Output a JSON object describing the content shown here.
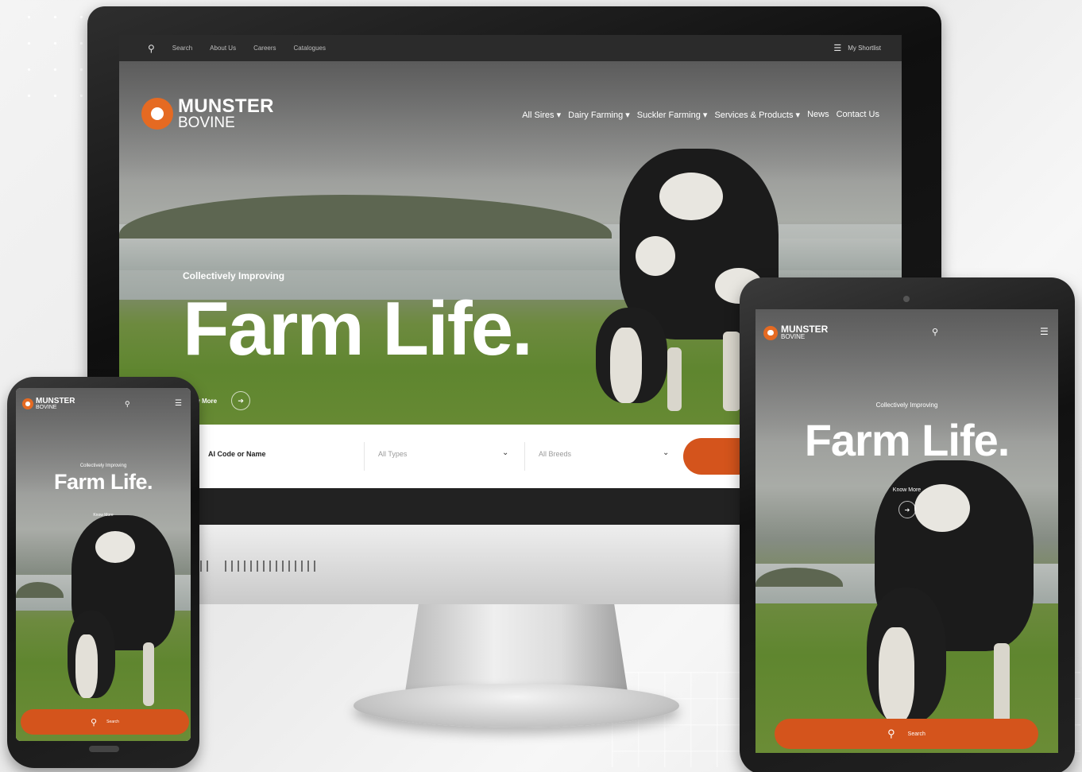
{
  "brand": {
    "name_line1": "MUNSTER",
    "name_line2": "BOVINE",
    "accent_color": "#d4541c"
  },
  "desktop": {
    "topbar": {
      "search_icon": "search-icon",
      "search_label": "Search",
      "links": [
        "About Us",
        "Careers",
        "Catalogues"
      ],
      "shortlist_icon": "list-icon",
      "shortlist_label": "My Shortlist"
    },
    "nav": [
      "All Sires ▾",
      "Dairy Farming ▾",
      "Suckler Farming ▾",
      "Services & Products ▾",
      "News",
      "Contact Us"
    ],
    "hero": {
      "kicker": "Collectively Improving",
      "title": "Farm Life.",
      "cta_label": "Know More",
      "cta_icon": "arrow-right-icon"
    },
    "search_bar": {
      "code_placeholder": "AI Code or Name",
      "types_select": "All Types",
      "breeds_select": "All Breeds",
      "dropdown_icon": "chevron-down-icon"
    }
  },
  "phone": {
    "hero": {
      "kicker": "Collectively Improving",
      "title": "Farm Life.",
      "cta_label": "Know More"
    },
    "search_button_label": "Search",
    "search_icon": "search-icon",
    "menu_icon": "menu-icon"
  },
  "tablet": {
    "hero": {
      "kicker": "Collectively Improving",
      "title": "Farm Life.",
      "cta_label": "Know More"
    },
    "search_button_label": "Search",
    "search_icon": "search-icon",
    "menu_icon": "menu-icon"
  }
}
